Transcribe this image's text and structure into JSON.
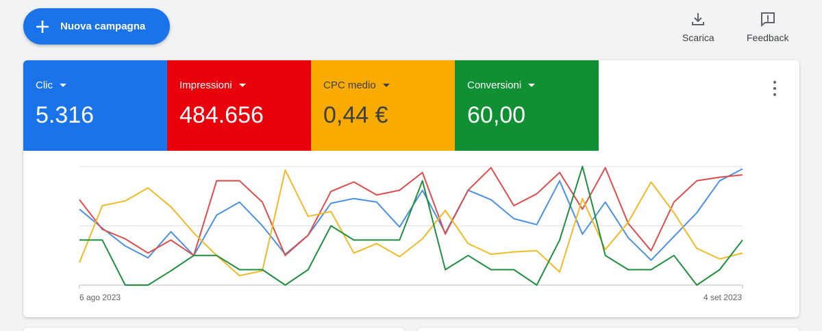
{
  "toolbar": {
    "new_campaign_label": "Nuova campagna",
    "download_label": "Scarica",
    "feedback_label": "Feedback"
  },
  "metrics": [
    {
      "name": "Clic",
      "value": "5.316",
      "color": "#1a73e8",
      "text_color": "#ffffff"
    },
    {
      "name": "Impressioni",
      "value": "484.656",
      "color": "#e8000b",
      "text_color": "#ffffff"
    },
    {
      "name": "CPC medio",
      "value": "0,44 €",
      "color": "#f9ab00",
      "text_color": "#3c4043"
    },
    {
      "name": "Conversioni",
      "value": "60,00",
      "color": "#109033",
      "text_color": "#ffffff"
    }
  ],
  "chart_data": {
    "type": "line",
    "x_start_label": "6 ago 2023",
    "x_end_label": "4 set 2023",
    "grid": true,
    "y_scale": "normalized per metric",
    "ylim": [
      0,
      1
    ],
    "series": [
      {
        "name": "Clic",
        "color": "#4a90e2",
        "values": [
          0.64,
          0.48,
          0.33,
          0.23,
          0.45,
          0.25,
          0.59,
          0.7,
          0.5,
          0.26,
          0.42,
          0.69,
          0.73,
          0.7,
          0.49,
          0.8,
          0.44,
          0.8,
          0.72,
          0.56,
          0.51,
          0.88,
          0.43,
          0.7,
          0.4,
          0.21,
          0.41,
          0.61,
          0.88,
          0.98
        ]
      },
      {
        "name": "Impressioni",
        "color": "#db4c4c",
        "values": [
          0.72,
          0.47,
          0.39,
          0.27,
          0.38,
          0.25,
          0.88,
          0.88,
          0.7,
          0.25,
          0.42,
          0.79,
          0.87,
          0.76,
          0.8,
          0.95,
          0.43,
          0.8,
          0.99,
          0.67,
          0.77,
          0.95,
          0.64,
          0.99,
          0.52,
          0.29,
          0.7,
          0.88,
          0.91,
          0.93
        ]
      },
      {
        "name": "CPC medio",
        "color": "#f0ba25",
        "values": [
          0.19,
          0.67,
          0.71,
          0.82,
          0.66,
          0.44,
          0.25,
          0.08,
          0.12,
          0.97,
          0.58,
          0.62,
          0.27,
          0.35,
          0.24,
          0.39,
          0.63,
          0.35,
          0.26,
          0.28,
          0.29,
          0.11,
          0.73,
          0.3,
          0.53,
          0.87,
          0.61,
          0.31,
          0.22,
          0.27
        ]
      },
      {
        "name": "Conversioni",
        "color": "#1e8e3e",
        "values": [
          0.38,
          0.38,
          0.0,
          0.0,
          0.12,
          0.25,
          0.25,
          0.13,
          0.13,
          0.0,
          0.13,
          0.5,
          0.38,
          0.38,
          0.38,
          0.88,
          0.13,
          0.25,
          0.13,
          0.13,
          0.0,
          0.38,
          1.0,
          0.25,
          0.13,
          0.13,
          0.25,
          0.0,
          0.13,
          0.38
        ]
      }
    ]
  }
}
